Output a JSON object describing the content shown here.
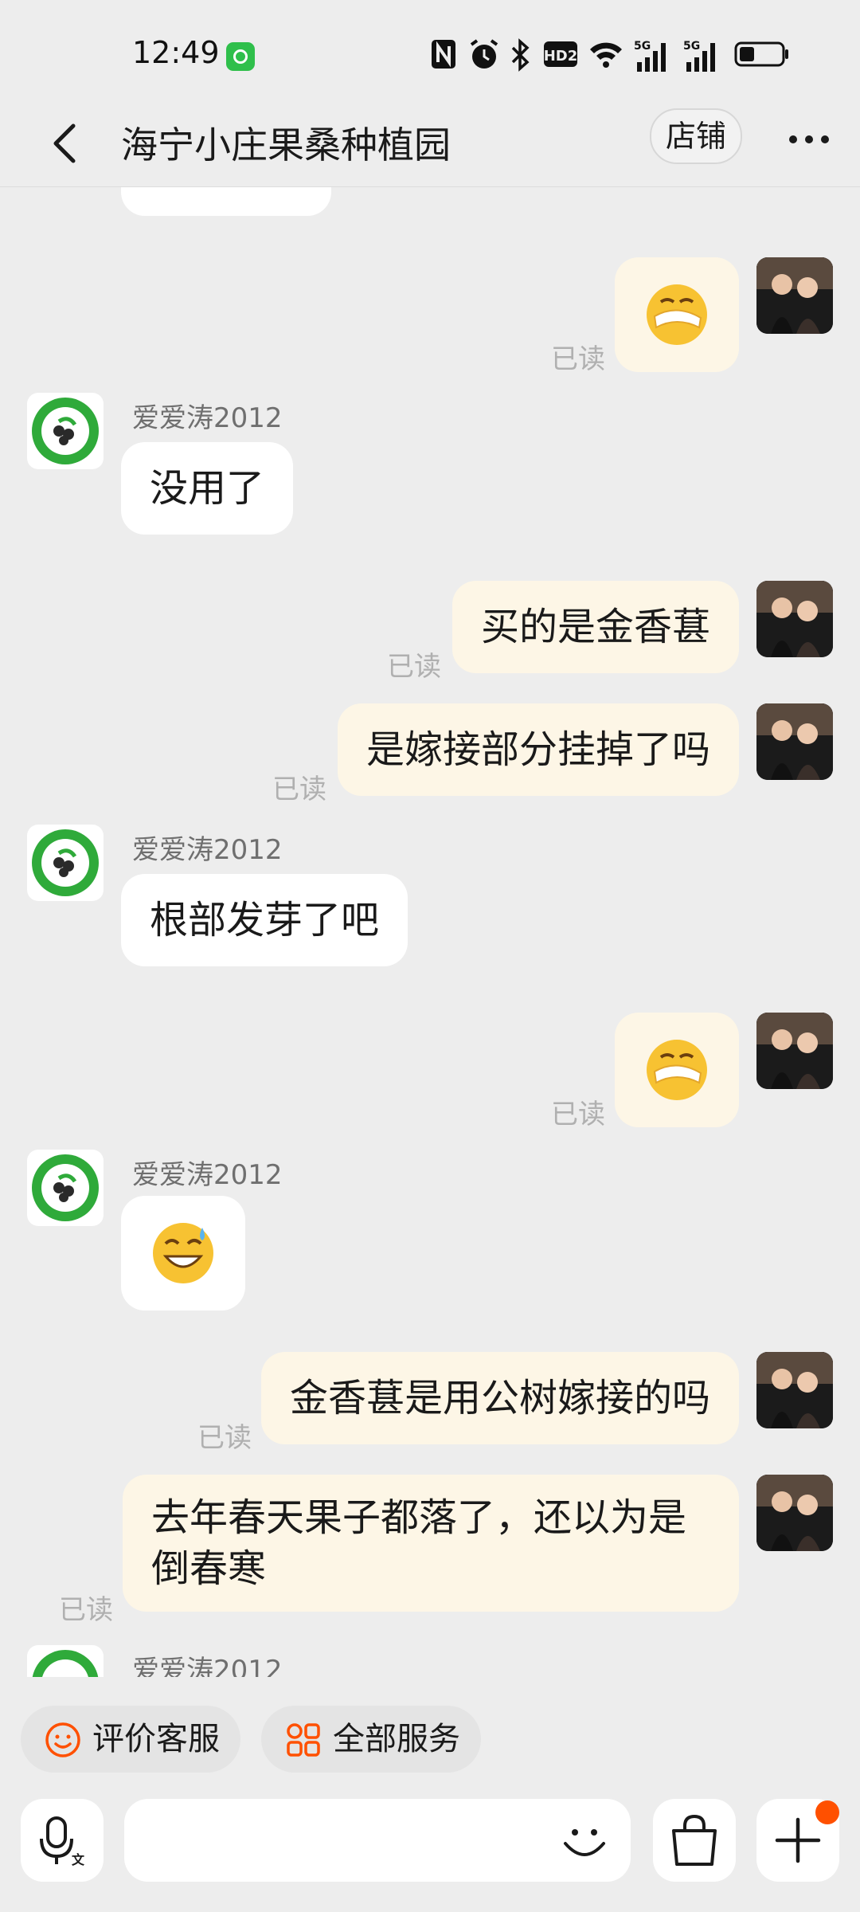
{
  "status_bar": {
    "time": "12:49",
    "signal_1_label": "5G",
    "signal_2_label": "5G",
    "hd_label": "HD2"
  },
  "header": {
    "title": "海宁小庄果桑种植园",
    "shop_button": "店铺"
  },
  "messages": [
    {
      "from": "me",
      "type": "sticker",
      "icon": "hand-over-face-emoji",
      "read": "已读"
    },
    {
      "from": "shop",
      "sender": "爱爱涛2012",
      "text": "没用了"
    },
    {
      "from": "me",
      "text": "买的是金香葚",
      "read": "已读"
    },
    {
      "from": "me",
      "text": "是嫁接部分挂掉了吗",
      "read": "已读"
    },
    {
      "from": "shop",
      "sender": "爱爱涛2012",
      "text": "根部发芽了吧"
    },
    {
      "from": "me",
      "type": "sticker",
      "icon": "hand-over-face-emoji",
      "read": "已读"
    },
    {
      "from": "shop",
      "sender": "爱爱涛2012",
      "type": "sticker",
      "icon": "grinning-sweat-emoji"
    },
    {
      "from": "me",
      "text": "金香葚是用公树嫁接的吗",
      "read": "已读"
    },
    {
      "from": "me",
      "text": "去年春天果子都落了，还以为是倒春寒",
      "read": "已读"
    },
    {
      "from": "shop",
      "sender": "爱爱涛2012"
    }
  ],
  "quick_actions": [
    {
      "label": "评价客服",
      "icon": "smile-face-icon"
    },
    {
      "label": "全部服务",
      "icon": "grid-services-icon"
    }
  ],
  "input": {
    "placeholder": ""
  },
  "colors": {
    "accent": "#ff5000",
    "out_bubble": "#fdf6e6",
    "in_bubble": "#ffffff",
    "background": "#ededed"
  }
}
